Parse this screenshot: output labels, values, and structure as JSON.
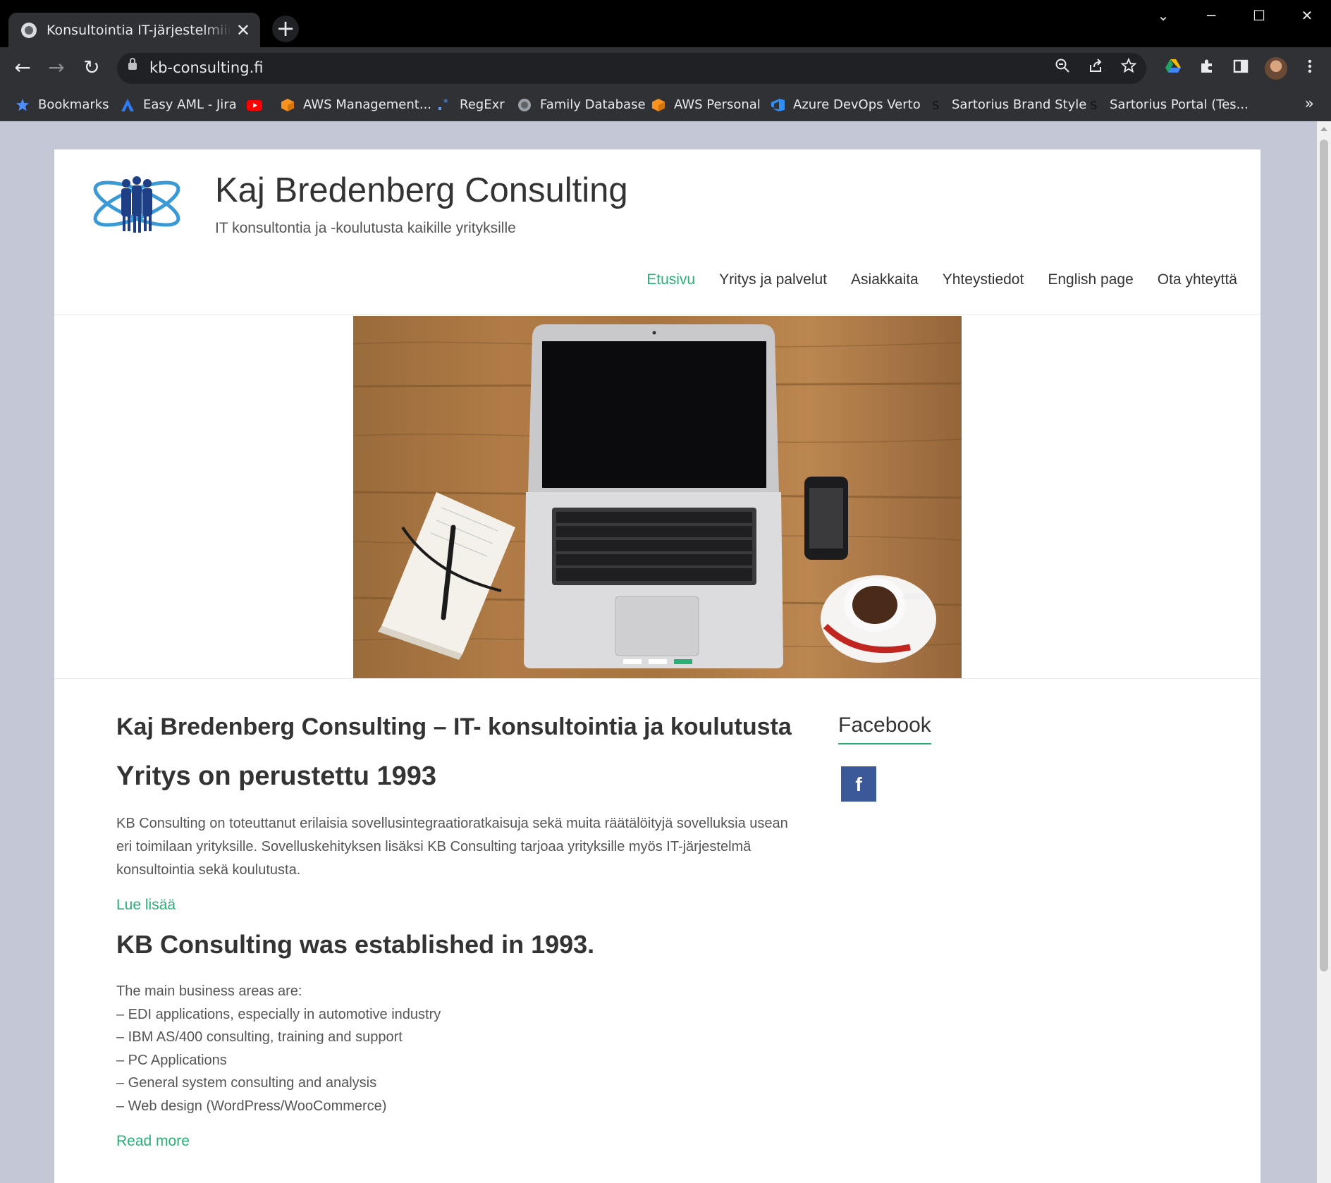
{
  "browser": {
    "tab_title": "Konsultointia IT-järjestelmiin sekä",
    "tab_close": "✕",
    "new_tab": "+",
    "url": "kb-consulting.fi",
    "controls": {
      "dropdown": "⌄",
      "minimize": "─",
      "maximize": "☐",
      "close": "✕"
    },
    "nav": {
      "back": "←",
      "forward": "→",
      "reload": "↻"
    },
    "bookmarks": [
      {
        "label": "Bookmarks",
        "icon": "star-icon",
        "color": "#4f8ef7"
      },
      {
        "label": "Easy AML - Jira",
        "icon": "jira-icon",
        "color": "#2f7bf5"
      },
      {
        "label": "",
        "icon": "youtube-icon",
        "color": "#ff0000"
      },
      {
        "label": "AWS Management...",
        "icon": "aws-cube-icon",
        "color": "#f7931e"
      },
      {
        "label": "RegExr",
        "icon": "regexr-icon",
        "color": "#5d9cec"
      },
      {
        "label": "Family Database",
        "icon": "globe-icon",
        "color": "#9aa0a6"
      },
      {
        "label": "AWS Personal",
        "icon": "aws-cube-icon",
        "color": "#f7931e"
      },
      {
        "label": "Azure DevOps Verto",
        "icon": "azure-devops-icon",
        "color": "#2f8ff7"
      },
      {
        "label": "Sartorius Brand Style",
        "icon": "sartorius-icon",
        "color": "#222222"
      },
      {
        "label": "Sartorius Portal (Tes...",
        "icon": "sartorius-icon",
        "color": "#222222"
      }
    ],
    "bookmarks_more": "»"
  },
  "site": {
    "title": "Kaj Bredenberg Consulting",
    "tagline": "IT konsultontia ja -koulutusta kaikille yrityksille",
    "nav": [
      {
        "label": "Etusivu",
        "current": true
      },
      {
        "label": "Yritys ja palvelut",
        "current": false
      },
      {
        "label": "Asiakkaita",
        "current": false
      },
      {
        "label": "Yhteystiedot",
        "current": false
      },
      {
        "label": "English page",
        "current": false
      },
      {
        "label": "Ota yhteyttä",
        "current": false
      }
    ],
    "slider": {
      "slides": 3,
      "active_slide": 3
    },
    "accent_color": "#29b074"
  },
  "main": {
    "heading": "Kaj Bredenberg Consulting – IT- konsultointia ja koulutusta",
    "subheading": "Yritys on perustettu 1993",
    "paragraph": "KB Consulting on toteuttanut erilaisia sovellusintegraatioratkaisuja sekä muita räätälöityjä sovelluksia usean eri toimilaan yrityksille. Sovelluskehityksen lisäksi KB Consulting tarjoaa yrityksille myös IT-järjestelmä konsultointia sekä koulutusta.",
    "read_more_fi": "Lue lisää",
    "heading_en": "KB Consulting was established in 1993.",
    "areas_intro": "The main business areas are:",
    "areas": [
      "– EDI applications, especially in automotive industry",
      "– IBM AS/400 consulting, training and support",
      "– PC Applications",
      "– General system consulting and analysis",
      "– Web design (WordPress/WooCommerce)"
    ],
    "read_more_en": "Read more"
  },
  "sidebar": {
    "widget_title": "Facebook",
    "fb_glyph": "f"
  }
}
